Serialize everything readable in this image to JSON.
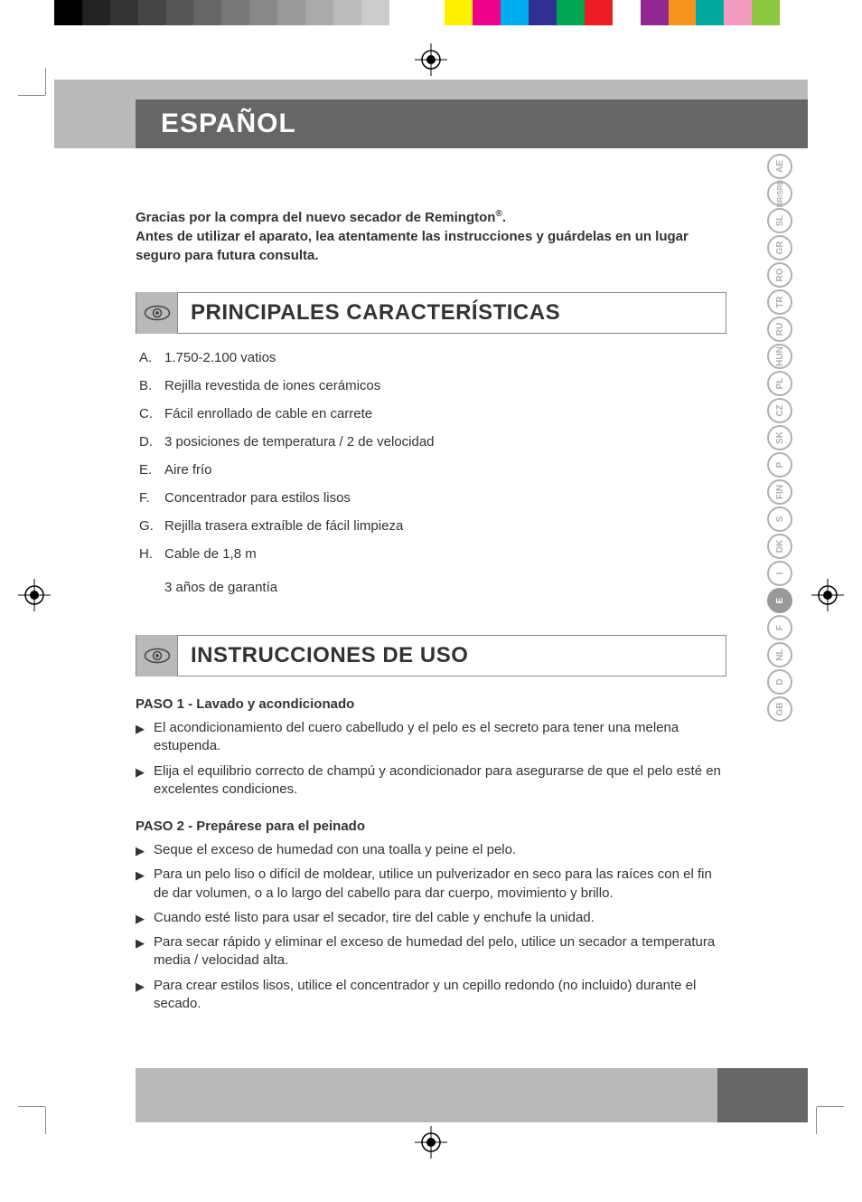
{
  "colorbar": [
    "#000000",
    "#222222",
    "#333333",
    "#444444",
    "#555555",
    "#666666",
    "#777777",
    "#888888",
    "#999999",
    "#aaaaaa",
    "#bbbbbb",
    "#cccccc",
    "#ffffff",
    "#ffffff",
    "#fff200",
    "#ec008c",
    "#00aeef",
    "#2e3192",
    "#00a651",
    "#ed1c24",
    "#ffffff",
    "#92278f",
    "#f7941d",
    "#00a99d",
    "#f49ac1",
    "#8dc63f",
    "#ffffff"
  ],
  "header": {
    "language_label": "ESPAÑOL"
  },
  "intro": {
    "line1_pre": "Gracias por la compra del nuevo secador de Remington",
    "line1_sup": "®",
    "line1_post": ".",
    "line2": "Antes de utilizar el aparato, lea atentamente las instrucciones y guárdelas en un lugar seguro para futura consulta."
  },
  "sections": {
    "features_title": "PRINCIPALES CARACTERÍSTICAS",
    "usage_title": "INSTRUCCIONES DE USO"
  },
  "features": [
    {
      "label": "A.",
      "text": "1.750-2.100 vatios"
    },
    {
      "label": "B.",
      "text": "Rejilla revestida de iones cerámicos"
    },
    {
      "label": "C.",
      "text": "Fácil enrollado de cable en carrete"
    },
    {
      "label": "D.",
      "text": "3 posiciones de temperatura / 2 de velocidad"
    },
    {
      "label": "E.",
      "text": "Aire frío"
    },
    {
      "label": "F.",
      "text": "Concentrador para estilos lisos"
    },
    {
      "label": "G.",
      "text": "Rejilla trasera extraíble de fácil limpieza"
    },
    {
      "label": "H.",
      "text": "Cable de 1,8 m"
    }
  ],
  "warranty": "3 años de garantía",
  "steps": [
    {
      "title": "PASO 1 - Lavado y acondicionado",
      "items": [
        "El acondicionamiento del cuero cabelludo y el pelo es el secreto para tener una melena estupenda.",
        "Elija el equilibrio correcto de champú y acondicionador para asegurarse de que el pelo esté en excelentes condiciones."
      ]
    },
    {
      "title": "PASO 2 - Prepárese para el peinado",
      "items": [
        "Seque el exceso de humedad con una toalla y peine el pelo.",
        "Para un pelo liso o difícil de moldear, utilice un pulverizador en seco para las raíces con el fin de dar volumen, o a lo largo del cabello para dar cuerpo, movimiento y brillo.",
        "Cuando esté listo para usar el secador, tire del cable y enchufe la unidad.",
        "Para secar rápido y eliminar el exceso de humedad del pelo, utilice un secador a temperatura media / velocidad alta.",
        "Para crear estilos lisos, utilice el concentrador y un cepillo redondo (no incluido) durante el secado."
      ]
    }
  ],
  "languages": [
    "GB",
    "D",
    "NL",
    "F",
    "E",
    "I",
    "DK",
    "S",
    "FIN",
    "P",
    "SK",
    "CZ",
    "PL",
    "HUN",
    "RU",
    "TR",
    "RO",
    "GR",
    "SL",
    "HR/SRB",
    "AE"
  ],
  "active_language": "E"
}
